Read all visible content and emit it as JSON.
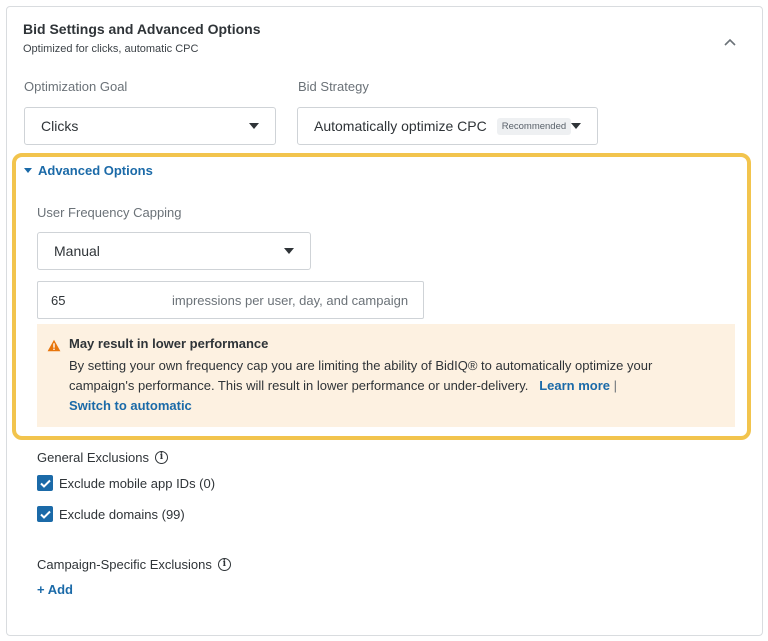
{
  "header": {
    "title": "Bid Settings and Advanced Options",
    "subtitle": "Optimized for clicks, automatic CPC"
  },
  "optimization_goal": {
    "label": "Optimization Goal",
    "value": "Clicks"
  },
  "bid_strategy": {
    "label": "Bid Strategy",
    "value": "Automatically optimize CPC",
    "badge": "Recommended"
  },
  "advanced": {
    "toggle_label": "Advanced Options",
    "frequency_label": "User Frequency Capping",
    "frequency_mode": "Manual",
    "frequency_value": "65",
    "frequency_suffix": "impressions per user, day, and campaign",
    "warning": {
      "title": "May result in lower performance",
      "body": "By setting your own frequency cap you are limiting the ability of BidIQ® to automatically optimize your campaign's performance. This will result in lower performance or under-delivery.",
      "learn_more": "Learn more",
      "separator": "|",
      "switch": "Switch to automatic"
    },
    "accent_color": "#f2c44d",
    "warning_bg": "#fdf1e1"
  },
  "general_exclusions": {
    "label": "General Exclusions",
    "items": [
      {
        "label": "Exclude mobile app IDs (0)",
        "checked": true
      },
      {
        "label": "Exclude domains (99)",
        "checked": true
      }
    ]
  },
  "campaign_exclusions": {
    "label": "Campaign-Specific Exclusions",
    "add_label": "+ Add"
  },
  "colors": {
    "link": "#1b6aa8",
    "text": "#2f3438",
    "muted": "#6b7278"
  }
}
